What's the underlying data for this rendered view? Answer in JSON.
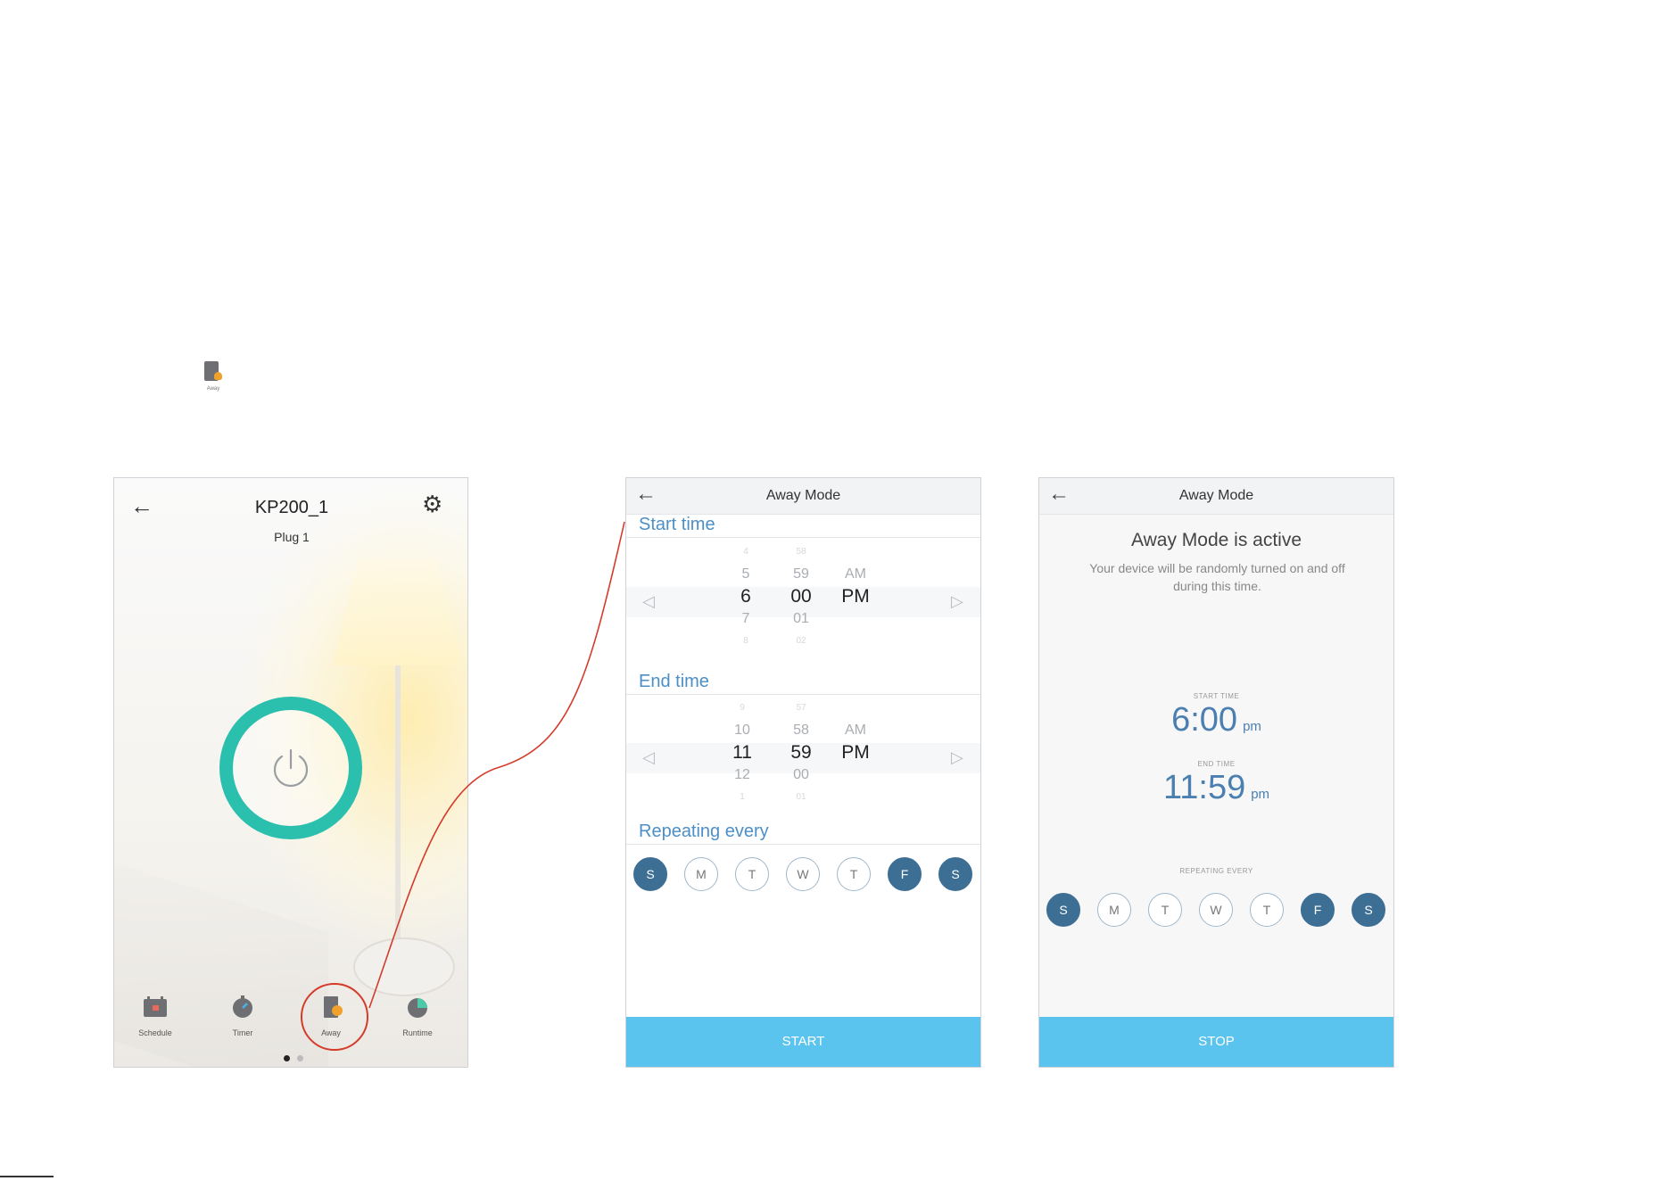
{
  "mini_icon": {
    "label": "Away"
  },
  "screen1": {
    "back_icon": "←",
    "title": "KP200_1",
    "subtitle": "Plug 1",
    "settings_icon": "⚙",
    "tabs": [
      {
        "label": "Schedule"
      },
      {
        "label": "Timer"
      },
      {
        "label": "Away"
      },
      {
        "label": "Runtime"
      }
    ],
    "accent_color": "#2bbfad",
    "highlight_color": "#d43b2a"
  },
  "screen2": {
    "back_icon": "←",
    "title": "Away Mode",
    "start_label": "Start time",
    "start_picker": {
      "hour": [
        "5",
        "6",
        "7"
      ],
      "minute": [
        "59",
        "00",
        "01"
      ],
      "ampm": [
        "AM",
        "PM"
      ]
    },
    "end_label": "End time",
    "end_picker": {
      "hour": [
        "10",
        "11",
        "12"
      ],
      "minute": [
        "58",
        "59",
        "00"
      ],
      "ampm": [
        "AM",
        "PM"
      ]
    },
    "repeat_label": "Repeating every",
    "days": [
      {
        "label": "S",
        "on": true
      },
      {
        "label": "M",
        "on": false
      },
      {
        "label": "T",
        "on": false
      },
      {
        "label": "W",
        "on": false
      },
      {
        "label": "T",
        "on": false
      },
      {
        "label": "F",
        "on": true
      },
      {
        "label": "S",
        "on": true
      }
    ],
    "button": "START"
  },
  "screen3": {
    "back_icon": "←",
    "title": "Away Mode",
    "status": "Away Mode is active",
    "description": "Your device will be randomly turned on and off during this time.",
    "start_cap": "START TIME",
    "start_time": "6:00",
    "start_ampm": "pm",
    "end_cap": "END TIME",
    "end_time": "11:59",
    "end_ampm": "pm",
    "repeat_cap": "REPEATING EVERY",
    "days": [
      {
        "label": "S",
        "on": true
      },
      {
        "label": "M",
        "on": false
      },
      {
        "label": "T",
        "on": false
      },
      {
        "label": "W",
        "on": false
      },
      {
        "label": "T",
        "on": false
      },
      {
        "label": "F",
        "on": true
      },
      {
        "label": "S",
        "on": true
      }
    ],
    "button": "STOP"
  }
}
